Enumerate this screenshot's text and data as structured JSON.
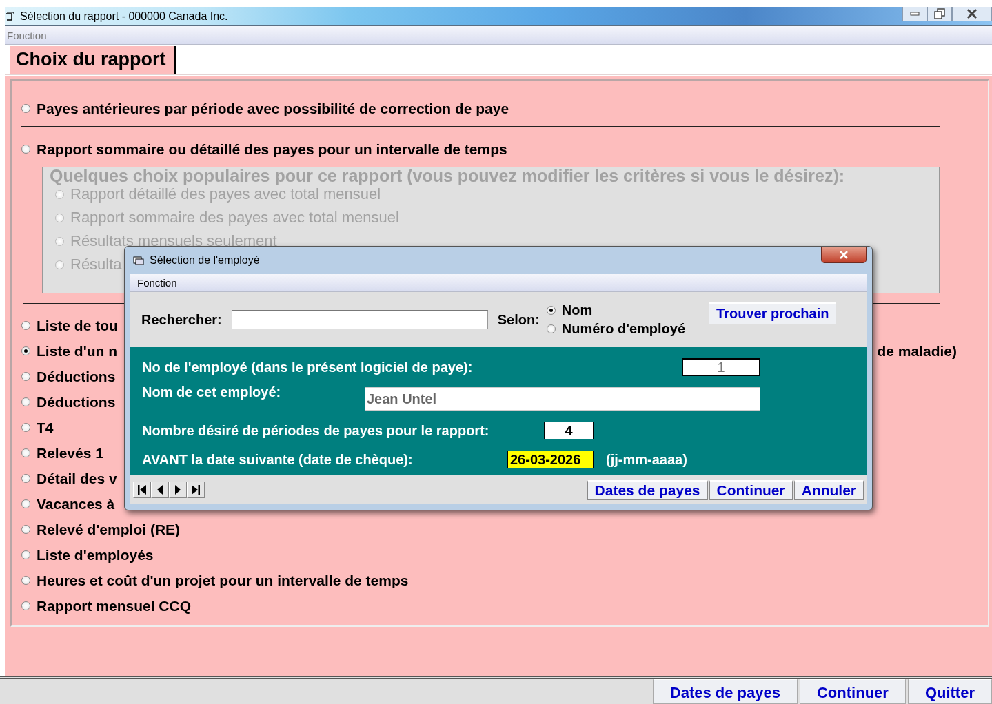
{
  "window": {
    "title": "Sélection du rapport - 000000 Canada Inc.",
    "menu": [
      "Fonction"
    ]
  },
  "tabs": [
    {
      "label": "Choix du rapport",
      "selected": true
    }
  ],
  "report_options": [
    {
      "kind": "option",
      "label": "Payes antérieures par période avec possibilité de correction de paye",
      "selected": false
    },
    {
      "kind": "divider"
    },
    {
      "kind": "option",
      "label": "Rapport sommaire ou détaillé des payes pour un intervalle de temps",
      "selected": false
    },
    {
      "kind": "group",
      "legend": "Quelques choix populaires pour ce rapport (vous pouvez modifier les critères si vous le désirez):",
      "disabled": true,
      "options": [
        {
          "label": "Rapport détaillé des payes avec total mensuel",
          "selected": false
        },
        {
          "label": "Rapport sommaire des payes avec total mensuel",
          "selected": false
        },
        {
          "label": "Résultats mensuels seulement",
          "selected": false
        },
        {
          "label": "Résulta",
          "selected": false
        }
      ]
    },
    {
      "kind": "divider"
    },
    {
      "kind": "option",
      "label": "Liste de tou",
      "selected": false
    },
    {
      "kind": "option",
      "label": "Liste d'un n",
      "trailing": "de maladie)",
      "selected": true
    },
    {
      "kind": "option",
      "label": "Déductions",
      "selected": false
    },
    {
      "kind": "option",
      "label": "Déductions",
      "selected": false
    },
    {
      "kind": "option",
      "label": "T4",
      "selected": false
    },
    {
      "kind": "option",
      "label": "Relevés 1",
      "selected": false
    },
    {
      "kind": "option",
      "label": "Détail des v",
      "selected": false
    },
    {
      "kind": "option",
      "label": "Vacances à",
      "selected": false
    },
    {
      "kind": "option",
      "label": "Relevé d'emploi (RE)",
      "selected": false
    },
    {
      "kind": "option",
      "label": "Liste d'employés",
      "selected": false
    },
    {
      "kind": "option",
      "label": "Heures et coût d'un projet pour un intervalle de temps",
      "selected": false
    },
    {
      "kind": "option",
      "label": "Rapport mensuel CCQ",
      "selected": false
    }
  ],
  "footer_buttons": [
    "Dates de payes",
    "Continuer",
    "Quitter"
  ],
  "dialog": {
    "title": "Sélection de l'employé",
    "menu": [
      "Fonction"
    ],
    "search": {
      "label": "Rechercher:"
    },
    "by": {
      "label": "Selon:",
      "options": [
        {
          "label": "Nom",
          "selected": true
        },
        {
          "label": "Numéro d'employé",
          "selected": false
        }
      ]
    },
    "find_button": "Trouver prochain",
    "fields": [
      {
        "kind": "number",
        "label": "No de l'employé (dans le présent logiciel de paye):",
        "value": "1"
      },
      {
        "kind": "name",
        "label": "Nom de cet employé:",
        "value": "Jean Untel"
      },
      {
        "kind": "count",
        "label": "Nombre désiré de périodes de payes pour le rapport:",
        "value": "4"
      },
      {
        "kind": "date",
        "label": "AVANT la date suivante (date de chèque):",
        "value": "26-03-2026",
        "hint": "(jj-mm-aaaa)"
      }
    ],
    "buttons": [
      "Dates de payes",
      "Continuer",
      "Annuler"
    ]
  }
}
